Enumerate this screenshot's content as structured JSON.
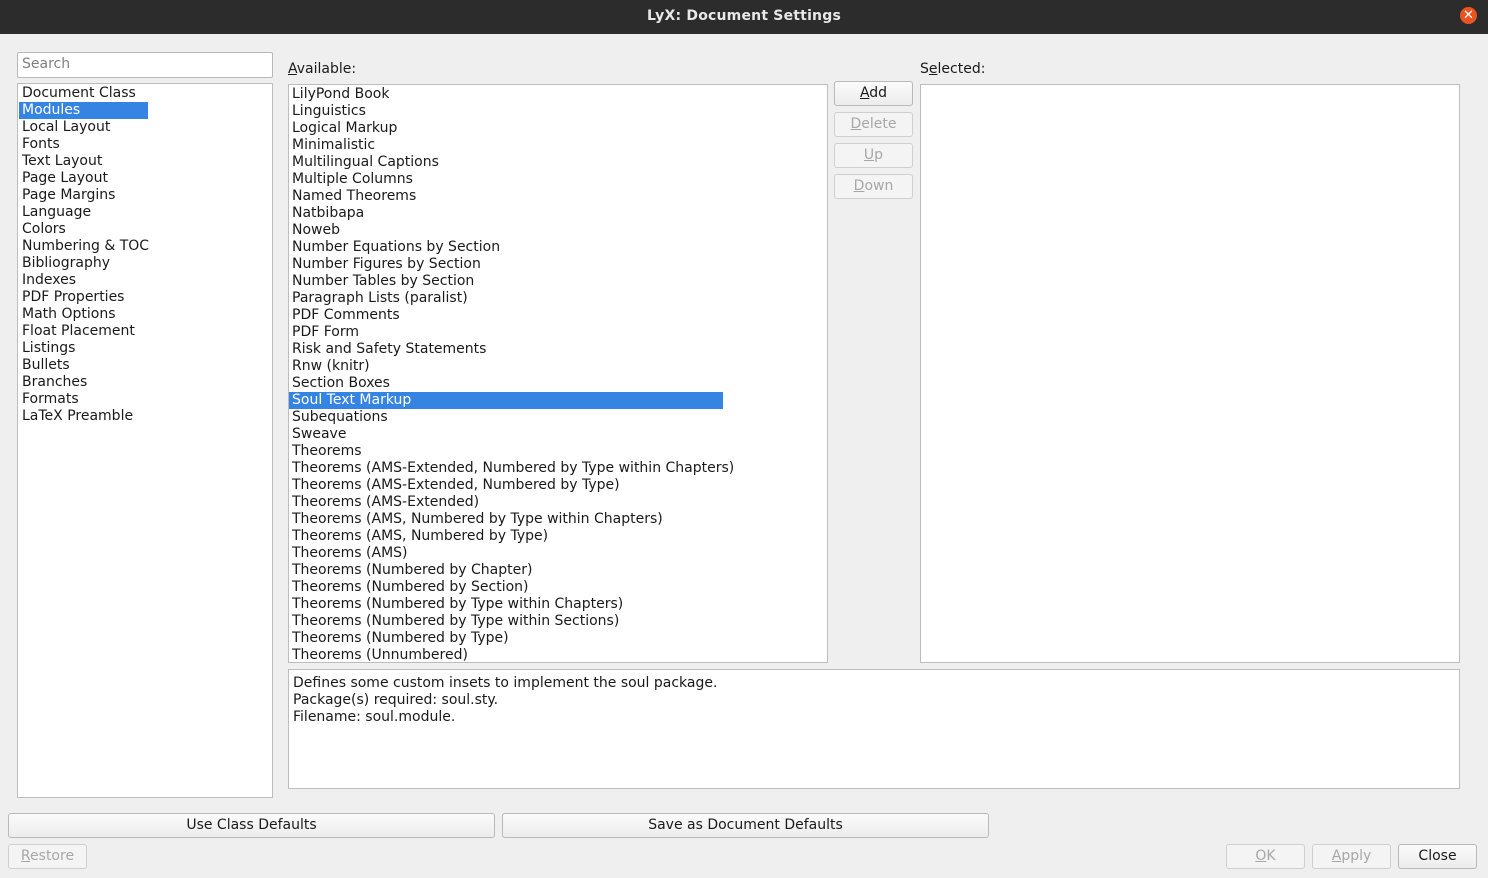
{
  "window": {
    "title": "LyX: Document Settings"
  },
  "search": {
    "placeholder": "Search"
  },
  "nav": {
    "items": [
      "Document Class",
      "Modules",
      "Local Layout",
      "Fonts",
      "Text Layout",
      "Page Layout",
      "Page Margins",
      "Language",
      "Colors",
      "Numbering & TOC",
      "Bibliography",
      "Indexes",
      "PDF Properties",
      "Math Options",
      "Float Placement",
      "Listings",
      "Bullets",
      "Branches",
      "Formats",
      "LaTeX Preamble"
    ],
    "selected": "Modules"
  },
  "available": {
    "label_accel": "A",
    "label_rest": "vailable:",
    "items": [
      "LilyPond Book",
      "Linguistics",
      "Logical Markup",
      "Minimalistic",
      "Multilingual Captions",
      "Multiple Columns",
      "Named Theorems",
      "Natbibapa",
      "Noweb",
      "Number Equations by Section",
      "Number Figures by Section",
      "Number Tables by Section",
      "Paragraph Lists (paralist)",
      "PDF Comments",
      "PDF Form",
      "Risk and Safety Statements",
      "Rnw (knitr)",
      "Section Boxes",
      "Soul Text Markup",
      "Subequations",
      "Sweave",
      "Theorems",
      "Theorems (AMS-Extended, Numbered by Type within Chapters)",
      "Theorems (AMS-Extended, Numbered by Type)",
      "Theorems (AMS-Extended)",
      "Theorems (AMS, Numbered by Type within Chapters)",
      "Theorems (AMS, Numbered by Type)",
      "Theorems (AMS)",
      "Theorems (Numbered by Chapter)",
      "Theorems (Numbered by Section)",
      "Theorems (Numbered by Type within Chapters)",
      "Theorems (Numbered by Type within Sections)",
      "Theorems (Numbered by Type)",
      "Theorems (Unnumbered)"
    ],
    "selected": "Soul Text Markup"
  },
  "selected_list": {
    "label_pre": "S",
    "label_accel": "e",
    "label_rest": "lected:",
    "items": []
  },
  "module_buttons": {
    "add": {
      "accel": "A",
      "rest": "dd"
    },
    "delete": {
      "accel": "D",
      "rest": "elete"
    },
    "up": {
      "accel": "U",
      "rest": "p"
    },
    "down": {
      "accel": "D",
      "rest": "own"
    }
  },
  "description": {
    "lines": [
      "Defines some custom insets to implement the soul package.",
      "Package(s) required: soul.sty.",
      "Filename: soul.module."
    ]
  },
  "bottom": {
    "use_class_defaults": "Use Class Defaults",
    "save_as_document_defaults": "Save as Document Defaults",
    "restore": {
      "accel": "R",
      "rest": "estore"
    },
    "ok": {
      "accel": "O",
      "rest": "K"
    },
    "apply": {
      "accel": "A",
      "rest": "pply"
    },
    "close": "Close"
  },
  "colors": {
    "selection": "#3584e4",
    "titlebar": "#2c2c2c",
    "close_button": "#e95420"
  }
}
